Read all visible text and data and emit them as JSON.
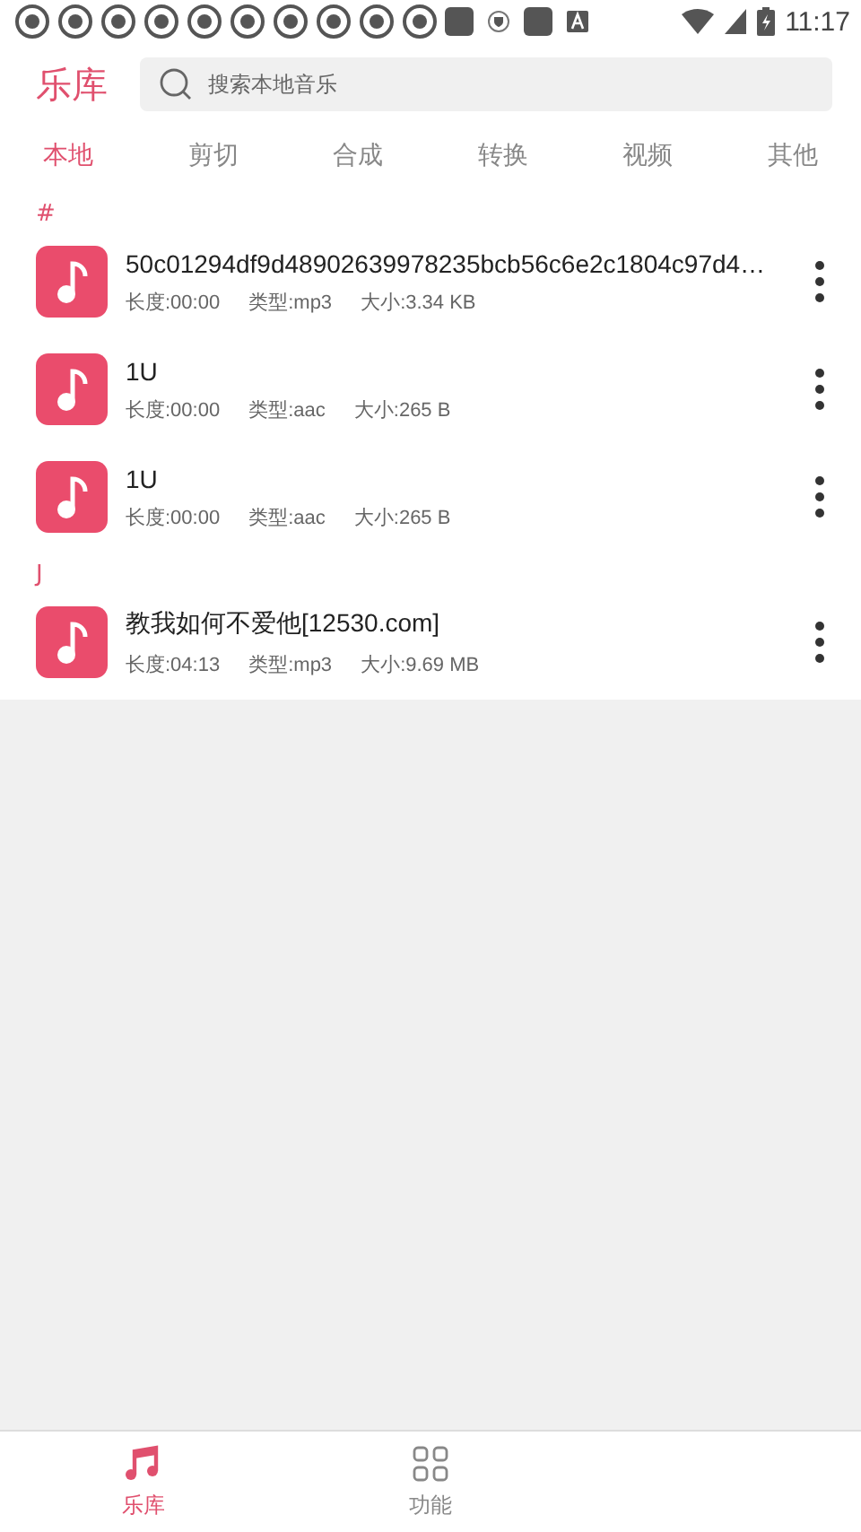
{
  "status_bar": {
    "icons": [
      {
        "kind": "ring"
      },
      {
        "kind": "ring"
      },
      {
        "kind": "ring"
      },
      {
        "kind": "ring"
      },
      {
        "kind": "ring"
      },
      {
        "kind": "ring"
      },
      {
        "kind": "ring"
      },
      {
        "kind": "ring"
      },
      {
        "kind": "ring"
      },
      {
        "kind": "ring"
      },
      {
        "kind": "square"
      },
      {
        "kind": "shield"
      },
      {
        "kind": "square"
      },
      {
        "kind": "keyboard"
      }
    ],
    "time": "11:17"
  },
  "header": {
    "title": "乐库",
    "search": {
      "placeholder": "搜索本地音乐"
    }
  },
  "tabs": [
    {
      "label": "本地",
      "selected": true
    },
    {
      "label": "剪切",
      "selected": false
    },
    {
      "label": "合成",
      "selected": false
    },
    {
      "label": "转换",
      "selected": false
    },
    {
      "label": "视频",
      "selected": false
    },
    {
      "label": "其他",
      "selected": false
    }
  ],
  "sections": [
    {
      "letter": "#",
      "items": [
        {
          "title": "50c01294df9d48902639978235bcb56c6e2c1804c97d4…",
          "length": "长度:00:00",
          "type": "类型:mp3",
          "size": "大小:3.34 KB"
        },
        {
          "title": "1U",
          "length": "长度:00:00",
          "type": "类型:aac",
          "size": "大小:265 B"
        },
        {
          "title": "1U",
          "length": "长度:00:00",
          "type": "类型:aac",
          "size": "大小:265 B"
        }
      ]
    },
    {
      "letter": "J",
      "items": [
        {
          "title": "教我如何不爱他[12530.com]",
          "length": "长度:04:13",
          "type": "类型:mp3",
          "size": "大小:9.69 MB"
        }
      ]
    }
  ],
  "bottom_nav": [
    {
      "label": "乐库",
      "kind": "music",
      "selected": true
    },
    {
      "label": "功能",
      "kind": "grid",
      "selected": false
    }
  ]
}
